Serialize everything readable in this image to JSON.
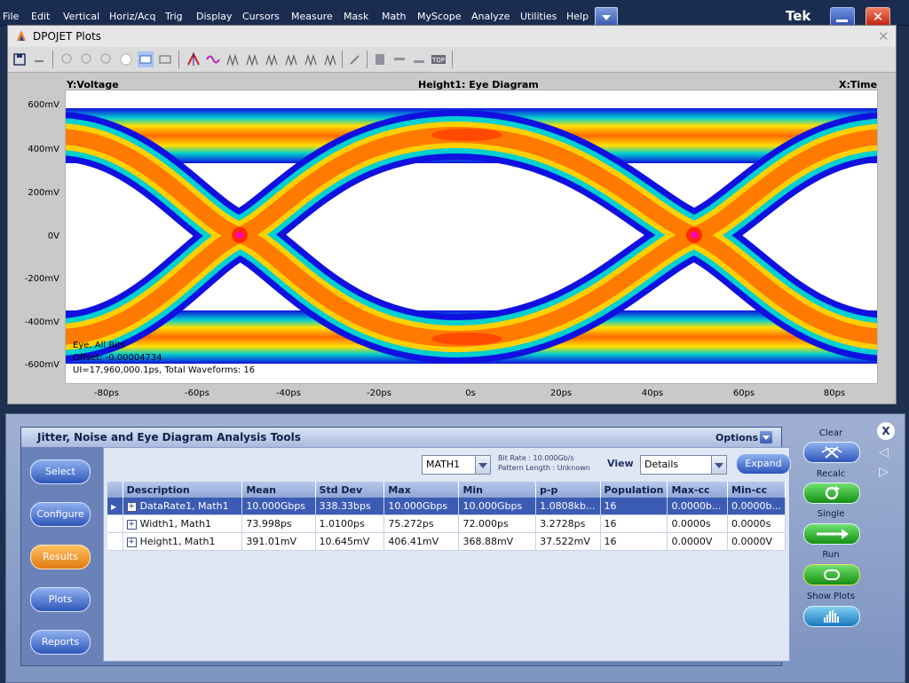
{
  "menu": {
    "items": [
      "File",
      "Edit",
      "Vertical",
      "Horiz/Acq",
      "Trig",
      "Display",
      "Cursors",
      "Measure",
      "Mask",
      "Math",
      "MyScope",
      "Analyze",
      "Utilities",
      "Help"
    ],
    "brand": "Tek"
  },
  "plot_window": {
    "title": "DPOJET Plots",
    "y_axis_title": "Y:Voltage",
    "plot_title": "Height1: Eye Diagram",
    "x_axis_title": "X:Time",
    "y_ticks": [
      "600mV",
      "400mV",
      "200mV",
      "0V",
      "-200mV",
      "-400mV",
      "-600mV"
    ],
    "x_ticks": [
      "-80ps",
      "-60ps",
      "-40ps",
      "-20ps",
      "0s",
      "20ps",
      "40ps",
      "60ps",
      "80ps"
    ],
    "annotations": [
      "Eye, All Bits",
      "Offset: -0.00004734",
      "UI=17,960,000.1ps, Total Waveforms: 16"
    ]
  },
  "analysis": {
    "title": "Jitter, Noise and Eye Diagram Analysis Tools",
    "options_label": "Options",
    "nav": [
      "Select",
      "Configure",
      "Results",
      "Plots",
      "Reports"
    ],
    "active_nav": "Results",
    "source": "MATH1",
    "bit_rate": "Bit Rate : 10.000Gb/s",
    "pattern_length": "Pattern Length : Unknown",
    "view_label": "View",
    "view_value": "Details",
    "expand_label": "Expand",
    "table": {
      "columns": [
        "Description",
        "Mean",
        "Std Dev",
        "Max",
        "Min",
        "p-p",
        "Population",
        "Max-cc",
        "Min-cc"
      ],
      "rows": [
        [
          "DataRate1, Math1",
          "10.000Gbps",
          "338.33bps",
          "10.000Gbps",
          "10.000Gbps",
          "1.0808kb...",
          "16",
          "0.0000b...",
          "0.0000b..."
        ],
        [
          "Width1, Math1",
          "73.998ps",
          "1.0100ps",
          "75.272ps",
          "72.000ps",
          "3.2728ps",
          "16",
          "0.0000s",
          "0.0000s"
        ],
        [
          "Height1, Math1",
          "391.01mV",
          "10.645mV",
          "406.41mV",
          "368.88mV",
          "37.522mV",
          "16",
          "0.0000V",
          "0.0000V"
        ]
      ]
    }
  },
  "controls": {
    "close": "X",
    "clear": "Clear",
    "recalc": "Recalc",
    "single": "Single",
    "run": "Run",
    "show_plots": "Show Plots"
  },
  "colors": {
    "eye_outer": "#1010e0",
    "eye_mid": "#00d0d0",
    "eye_core": "#ff8c00",
    "selection": "#3c5cb4"
  }
}
